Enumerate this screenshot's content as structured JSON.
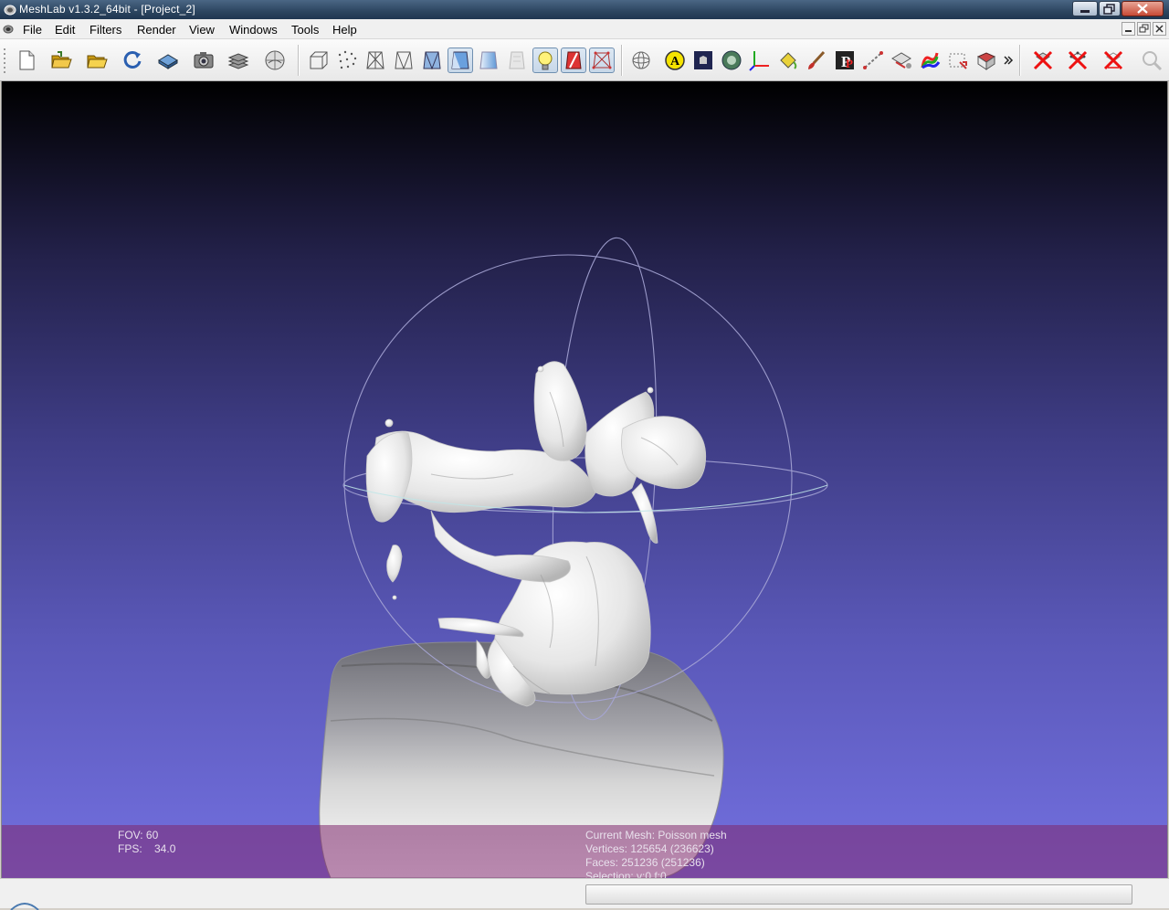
{
  "window": {
    "title": "MeshLab v1.3.2_64bit - [Project_2]"
  },
  "menu": {
    "items": [
      "File",
      "Edit",
      "Filters",
      "Render",
      "View",
      "Windows",
      "Tools",
      "Help"
    ]
  },
  "toolbar": {
    "buttons": [
      {
        "name": "new-project-icon",
        "checked": false
      },
      {
        "name": "open-project-icon",
        "checked": false
      },
      {
        "name": "import-mesh-icon",
        "checked": false
      },
      {
        "name": "reload-icon",
        "checked": false
      },
      {
        "name": "export-mesh-icon",
        "checked": false
      },
      {
        "name": "snapshot-icon",
        "checked": false
      },
      {
        "name": "layers-icon",
        "checked": false
      },
      {
        "name": "raster-icon",
        "checked": false
      },
      {
        "name": "bbox-render-icon",
        "checked": false
      },
      {
        "name": "points-render-icon",
        "checked": false
      },
      {
        "name": "wireframe-render-icon",
        "checked": false
      },
      {
        "name": "hidden-lines-render-icon",
        "checked": false
      },
      {
        "name": "flat-lines-render-icon",
        "checked": false
      },
      {
        "name": "flat-render-icon",
        "checked": true
      },
      {
        "name": "smooth-render-icon",
        "checked": false
      },
      {
        "name": "texture-render-icon",
        "checked": false
      },
      {
        "name": "lighting-icon",
        "checked": true
      },
      {
        "name": "backface-culling-icon",
        "checked": true
      },
      {
        "name": "selected-faces-icon",
        "checked": true
      },
      {
        "name": "trackball-icon",
        "checked": false
      },
      {
        "name": "annotation-icon",
        "checked": false
      },
      {
        "name": "shader-icon",
        "checked": false
      },
      {
        "name": "ambient-occlusion-icon",
        "checked": false
      },
      {
        "name": "axis-icon",
        "checked": false
      },
      {
        "name": "paint-bucket-icon",
        "checked": false
      },
      {
        "name": "paint-brush-icon",
        "checked": false
      },
      {
        "name": "pickpoints-icon",
        "checked": false
      },
      {
        "name": "measure-icon",
        "checked": false
      },
      {
        "name": "align-icon",
        "checked": false
      },
      {
        "name": "manipulator-icon",
        "checked": false
      },
      {
        "name": "quality-mapper-icon",
        "checked": false
      },
      {
        "name": "select-faces-icon",
        "checked": false
      },
      {
        "name": "select-region-icon",
        "checked": false
      },
      {
        "name": "more-icon",
        "checked": false
      },
      {
        "name": "delete-faces-icon",
        "checked": false
      },
      {
        "name": "delete-vertices-icon",
        "checked": false
      },
      {
        "name": "delete-all-icon",
        "checked": false
      },
      {
        "name": "search-icon",
        "checked": false
      }
    ]
  },
  "info": {
    "fov": "FOV: 60",
    "fps": "FPS:    34.0",
    "current_mesh": "Current Mesh: Poisson mesh",
    "vertices": "Vertices: 125654 (236623)",
    "faces": "Faces: 251236 (251236)",
    "selection": "Selection: v:0 f:0"
  },
  "colors": {
    "info_text": "#e8e0ec",
    "mesh": "#f2f2f2",
    "trackball": "#a7a6d6"
  }
}
